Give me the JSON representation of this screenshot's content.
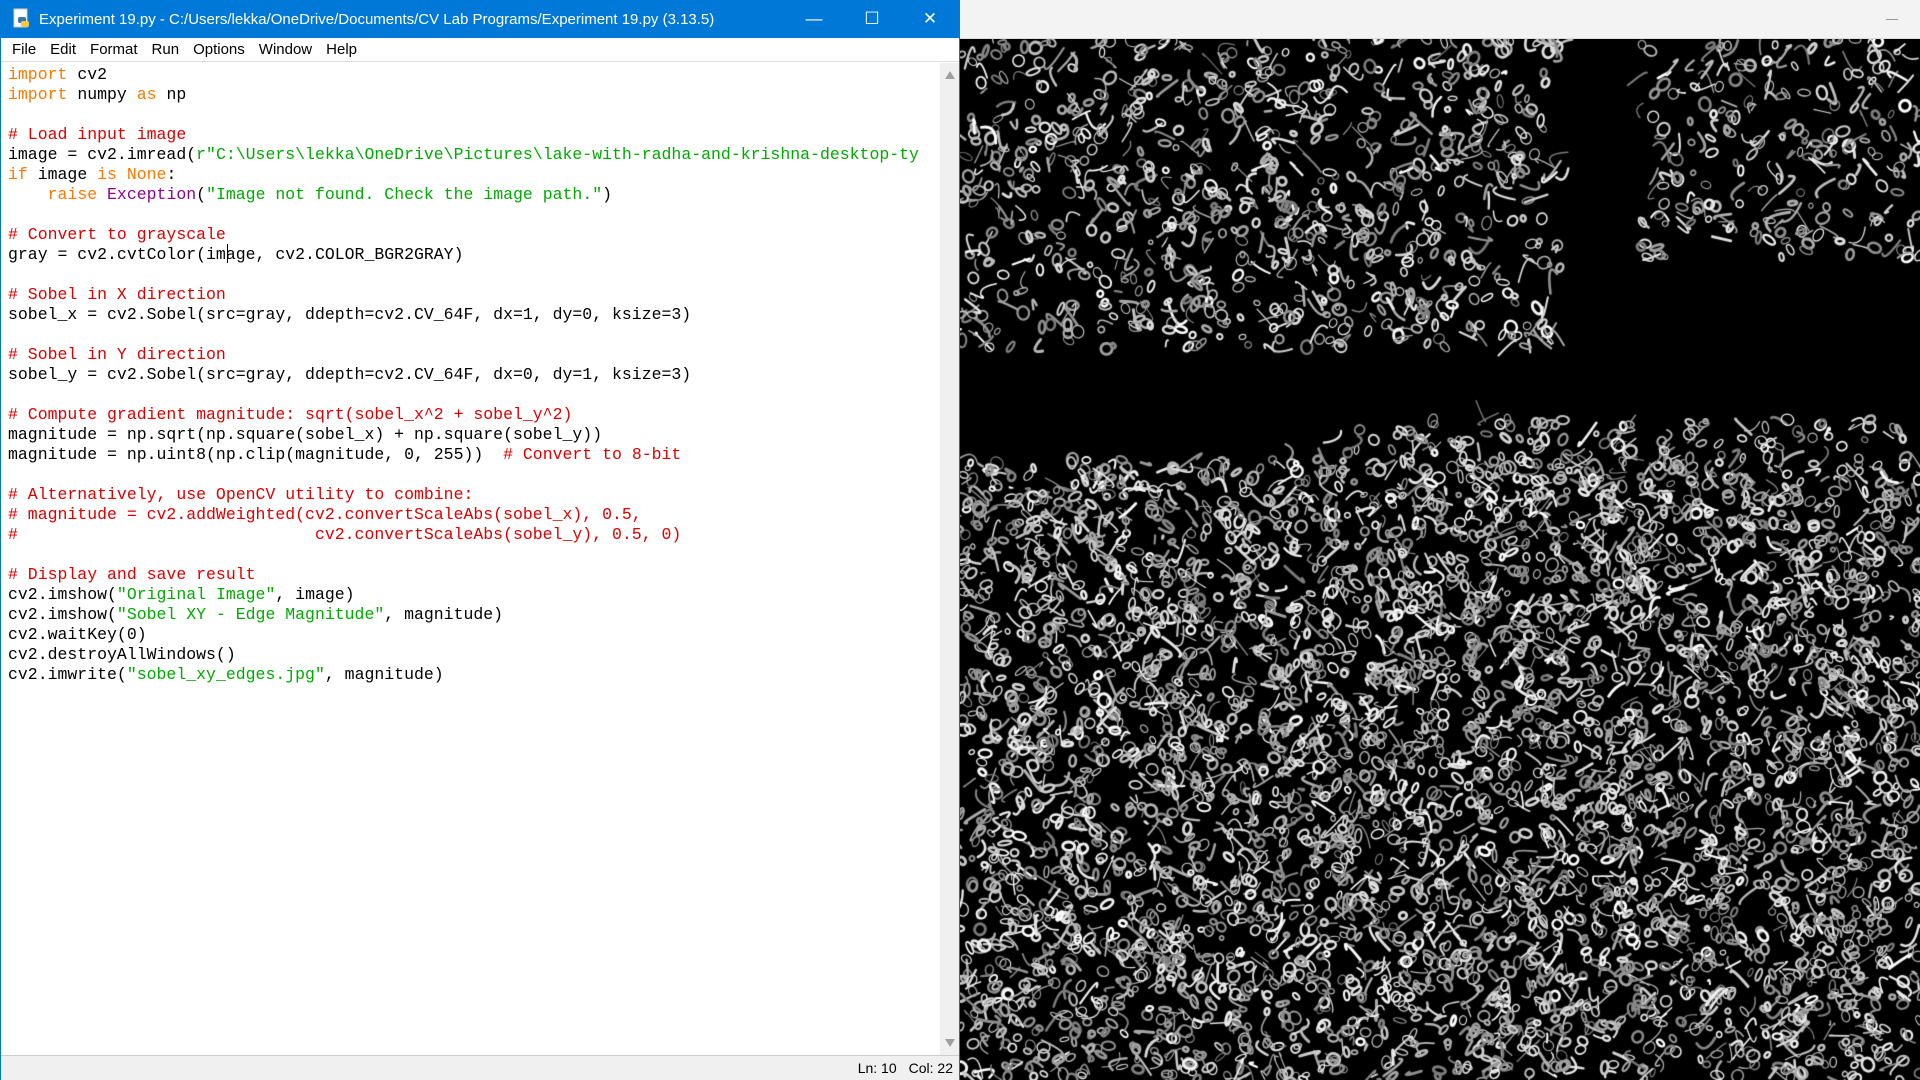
{
  "window": {
    "title": "Experiment 19.py - C:/Users/lekka/OneDrive/Documents/CV Lab Programs/Experiment 19.py (3.13.5)",
    "minimize": "—",
    "maximize": "☐",
    "close": "✕"
  },
  "menu": [
    "File",
    "Edit",
    "Format",
    "Run",
    "Options",
    "Window",
    "Help"
  ],
  "code": [
    [
      [
        "import",
        "kw"
      ],
      [
        " cv2",
        ""
      ]
    ],
    [
      [
        "import",
        "kw"
      ],
      [
        " numpy ",
        ""
      ],
      [
        "as",
        "kw"
      ],
      [
        " np",
        ""
      ]
    ],
    [],
    [
      [
        "# Load input image",
        "cm"
      ]
    ],
    [
      [
        "image = cv2.imread(",
        ""
      ],
      [
        "r\"C:\\Users\\lekka\\OneDrive\\Pictures\\lake-with-radha-and-krishna-desktop-ty",
        "st"
      ]
    ],
    [
      [
        "if",
        "kw"
      ],
      [
        " image ",
        ""
      ],
      [
        "is",
        "kw"
      ],
      [
        " ",
        ""
      ],
      [
        "None",
        "kw"
      ],
      [
        ":",
        ""
      ]
    ],
    [
      [
        "    ",
        ""
      ],
      [
        "raise",
        "kw"
      ],
      [
        " ",
        ""
      ],
      [
        "Exception",
        "bi"
      ],
      [
        "(",
        ""
      ],
      [
        "\"Image not found. Check the image path.\"",
        "st"
      ],
      [
        ")",
        ""
      ]
    ],
    [],
    [
      [
        "# Convert to grayscale",
        "cm"
      ]
    ],
    [
      [
        "gray = cv2.cvtColor(image, cv2.COLOR_BGR2GRAY)",
        ""
      ]
    ],
    [],
    [
      [
        "# Sobel in X direction",
        "cm"
      ]
    ],
    [
      [
        "sobel_x = cv2.Sobel(src=gray, ddepth=cv2.CV_64F, dx=1, dy=0, ksize=3)",
        ""
      ]
    ],
    [],
    [
      [
        "# Sobel in Y direction",
        "cm"
      ]
    ],
    [
      [
        "sobel_y = cv2.Sobel(src=gray, ddepth=cv2.CV_64F, dx=0, dy=1, ksize=3)",
        ""
      ]
    ],
    [],
    [
      [
        "# Compute gradient magnitude: sqrt(sobel_x^2 + sobel_y^2)",
        "cm"
      ]
    ],
    [
      [
        "magnitude = np.sqrt(np.square(sobel_x) + np.square(sobel_y))",
        ""
      ]
    ],
    [
      [
        "magnitude = np.uint8(np.clip(magnitude, 0, 255))  ",
        ""
      ],
      [
        "# Convert to 8-bit",
        "cm"
      ]
    ],
    [],
    [
      [
        "# Alternatively, use OpenCV utility to combine:",
        "cm"
      ]
    ],
    [
      [
        "# magnitude = cv2.addWeighted(cv2.convertScaleAbs(sobel_x), 0.5,",
        "cm"
      ]
    ],
    [
      [
        "#                              cv2.convertScaleAbs(sobel_y), 0.5, 0)",
        "cm"
      ]
    ],
    [],
    [
      [
        "# Display and save result",
        "cm"
      ]
    ],
    [
      [
        "cv2.imshow(",
        ""
      ],
      [
        "\"Original Image\"",
        "st"
      ],
      [
        ", image)",
        ""
      ]
    ],
    [
      [
        "cv2.imshow(",
        ""
      ],
      [
        "\"Sobel XY - Edge Magnitude\"",
        "st"
      ],
      [
        ", magnitude)",
        ""
      ]
    ],
    [
      [
        "cv2.waitKey(0)",
        ""
      ]
    ],
    [
      [
        "cv2.destroyAllWindows()",
        ""
      ]
    ],
    [
      [
        "cv2.imwrite(",
        ""
      ],
      [
        "\"sobel_xy_edges.jpg\"",
        "st"
      ],
      [
        ", magnitude)",
        ""
      ]
    ]
  ],
  "status": {
    "line": "Ln: 10",
    "col": "Col: 22"
  },
  "colors": {
    "titlebar": "#0078d7",
    "keyword": "#ff7700",
    "comment": "#dd0000",
    "string": "#00aa00",
    "builtin": "#900090"
  }
}
